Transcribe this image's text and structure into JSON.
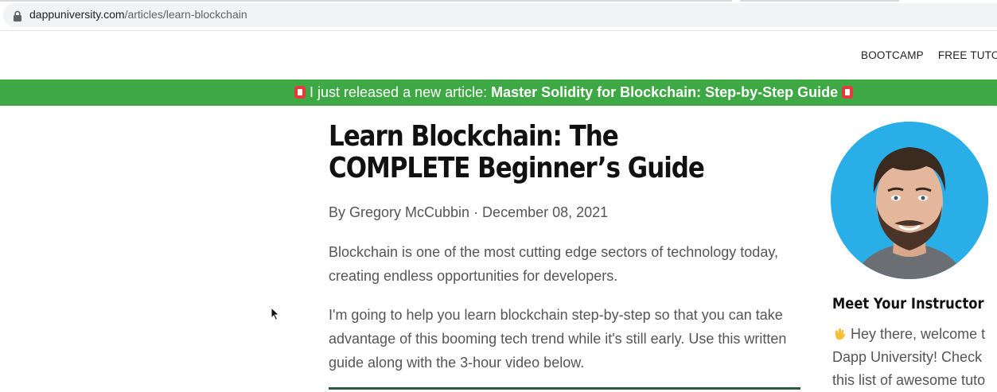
{
  "browser": {
    "url_host": "dappuniversity.com",
    "url_path": "/articles/learn-blockchain"
  },
  "nav": {
    "items": [
      "BOOTCAMP",
      "FREE TUTORI"
    ]
  },
  "banner": {
    "prefix": " I just released a new article: ",
    "link": "Master Solidity for Blockchain: Step-by-Step Guide",
    "emoji_icon": "gift-icon",
    "color": "#3ea845"
  },
  "article": {
    "title": "Learn Blockchain: The COMPLETE Beginner’s Guide",
    "byline": "By Gregory McCubbin · December 08, 2021",
    "paragraphs": [
      "Blockchain is one of the most cutting edge sectors of technology today, creating endless opportunities for developers.",
      "I'm going to help you learn blockchain step-by-step so that you can take advantage of this booming tech trend while it's still early. Use this written guide along with the 3-hour video below."
    ]
  },
  "sidebar": {
    "heading": "Meet Your Instructor",
    "lines": [
      "Hey there, welcome t",
      "Dapp University! Check",
      "this list of awesome tuto"
    ],
    "wave_icon": "waving-hand-icon",
    "avatar_bg": "#29aee8"
  }
}
